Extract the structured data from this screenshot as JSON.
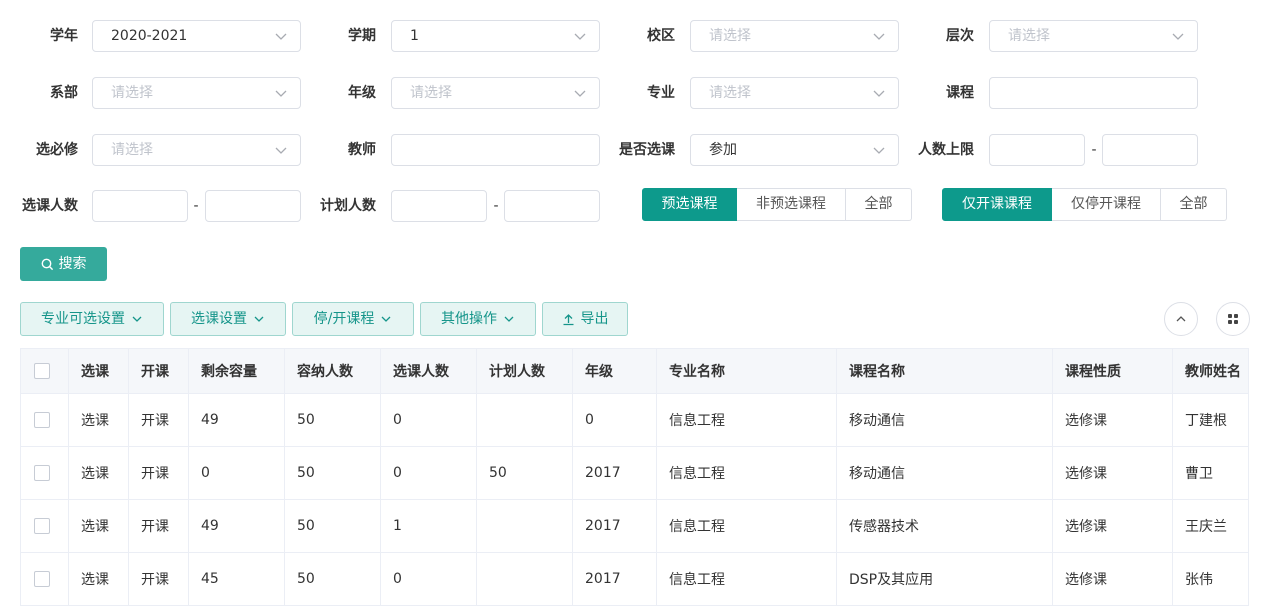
{
  "filters": {
    "academic_year": {
      "label": "学年",
      "value": "2020-2021"
    },
    "term": {
      "label": "学期",
      "value": "1"
    },
    "campus": {
      "label": "校区",
      "placeholder": "请选择"
    },
    "level": {
      "label": "层次",
      "placeholder": "请选择"
    },
    "department": {
      "label": "系部",
      "placeholder": "请选择"
    },
    "grade": {
      "label": "年级",
      "placeholder": "请选择"
    },
    "major": {
      "label": "专业",
      "placeholder": "请选择"
    },
    "course": {
      "label": "课程",
      "value": ""
    },
    "required_elective": {
      "label": "选必修",
      "placeholder": "请选择"
    },
    "teacher": {
      "label": "教师",
      "value": ""
    },
    "is_selected": {
      "label": "是否选课",
      "value": "参加"
    },
    "capacity_limit": {
      "label": "人数上限",
      "dash": "-"
    },
    "enrolled_count": {
      "label": "选课人数",
      "dash": "-"
    },
    "planned_count": {
      "label": "计划人数",
      "dash": "-"
    }
  },
  "preselect_toggle": {
    "options": [
      "预选课程",
      "非预选课程",
      "全部"
    ],
    "active": 0
  },
  "open_toggle": {
    "options": [
      "仅开课课程",
      "仅停开课程",
      "全部"
    ],
    "active": 0
  },
  "search_button": {
    "label": "搜索"
  },
  "toolbar": {
    "major_settings": "专业可选设置",
    "selection_settings": "选课设置",
    "stop_open": "停/开课程",
    "other_ops": "其他操作",
    "export": "导出"
  },
  "table": {
    "headers": [
      "选课",
      "开课",
      "剩余容量",
      "容纳人数",
      "选课人数",
      "计划人数",
      "年级",
      "专业名称",
      "课程名称",
      "课程性质",
      "教师姓名"
    ],
    "rows": [
      [
        "选课",
        "开课",
        "49",
        "50",
        "0",
        "",
        "0",
        "信息工程",
        "移动通信",
        "选修课",
        "丁建根"
      ],
      [
        "选课",
        "开课",
        "0",
        "50",
        "0",
        "50",
        "2017",
        "信息工程",
        "移动通信",
        "选修课",
        "曹卫"
      ],
      [
        "选课",
        "开课",
        "49",
        "50",
        "1",
        "",
        "2017",
        "信息工程",
        "传感器技术",
        "选修课",
        "王庆兰"
      ],
      [
        "选课",
        "开课",
        "45",
        "50",
        "0",
        "",
        "2017",
        "信息工程",
        "DSP及其应用",
        "选修课",
        "张伟"
      ]
    ]
  },
  "colors": {
    "accent": "#0d9a8c",
    "button": "#35aa9c",
    "toolbar_bg": "#e6f5f3",
    "link": "#13958a"
  }
}
